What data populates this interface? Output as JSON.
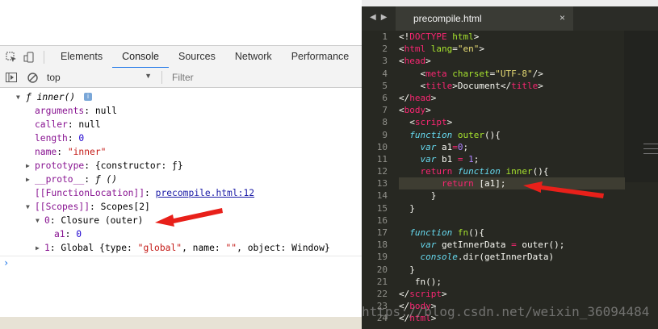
{
  "devtools": {
    "tabs": [
      "Elements",
      "Console",
      "Sources",
      "Network",
      "Performance"
    ],
    "active_tab": "Console",
    "context": "top",
    "filter_placeholder": "Filter",
    "tree": {
      "fn_header": "ƒ inner()",
      "arguments_key": "arguments",
      "arguments_val": "null",
      "caller_key": "caller",
      "caller_val": "null",
      "length_key": "length",
      "length_val": "0",
      "name_key": "name",
      "name_val": "\"inner\"",
      "prototype_key": "prototype",
      "prototype_val": "{constructor: ƒ}",
      "proto_key": "__proto__",
      "proto_val": "ƒ ()",
      "location_key": "[[FunctionLocation]]",
      "location_val": "precompile.html:12",
      "scopes_key": "[[Scopes]]",
      "scopes_val": "Scopes[2]",
      "closure_idx": "0",
      "closure_val": "Closure (outer)",
      "a1_key": "a1",
      "a1_val": "0",
      "global_idx": "1",
      "global_pre": "Global {type: ",
      "global_type": "\"global\"",
      "global_mid": ", name: ",
      "global_name": "\"\"",
      "global_post": ", object: Window}"
    },
    "prompt": "›"
  },
  "editor": {
    "tab_title": "precompile.html",
    "tab_close": "×",
    "window_title": "precompile.html",
    "line_numbers": [
      "1",
      "2",
      "3",
      "4",
      "5",
      "6",
      "7",
      "8",
      "9",
      "10",
      "11",
      "12",
      "13",
      "14",
      "15",
      "16",
      "17",
      "18",
      "19",
      "20",
      "21",
      "22",
      "23",
      "24"
    ]
  },
  "watermark": "https://blog.csdn.net/weixin_36094484",
  "colors": {
    "arrow": "#e8201a",
    "accent": "#1a73e8"
  }
}
